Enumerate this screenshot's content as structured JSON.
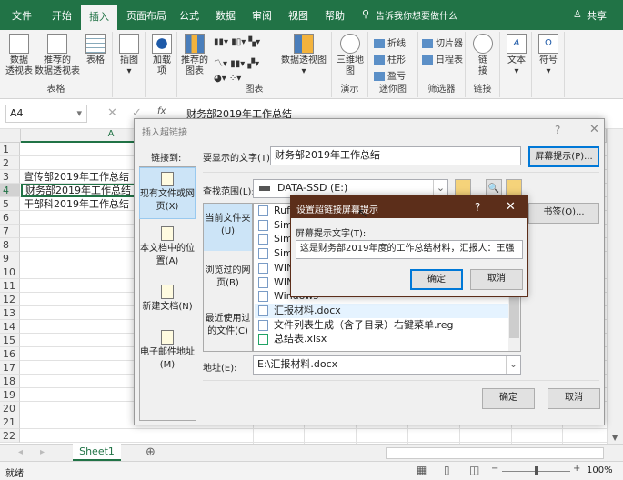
{
  "ribbon_tabs": [
    "文件",
    "开始",
    "插入",
    "页面布局",
    "公式",
    "数据",
    "审阅",
    "视图",
    "帮助"
  ],
  "active_tab": "插入",
  "search_placeholder": "告诉我你想要做什么",
  "share_label": "共享",
  "ribbon": {
    "pivot_table": "数据\n透视表",
    "recommended_pivot": "推荐的\n数据透视表",
    "table": "表格",
    "group_tables": "表格",
    "illustrations": "插图",
    "addins": "加载\n项",
    "recommended_charts": "推荐的\n图表",
    "pivot_chart": "数据透视图",
    "group_charts": "图表",
    "map3d": "三维地\n图",
    "group_tours": "演示",
    "spark_line": "折线",
    "spark_column": "柱形",
    "spark_winloss": "盈亏",
    "group_sparklines": "迷你图",
    "slicer": "切片器",
    "timeline": "日程表",
    "group_filters": "筛选器",
    "link": "链\n接",
    "group_links": "链接",
    "text": "文本",
    "symbols": "符号"
  },
  "formula_bar": {
    "name_box": "A4",
    "fx": "fx",
    "value": "财务部2019年工作总结"
  },
  "sheet": {
    "column_headers": [
      "A"
    ],
    "row_count": 22,
    "cells": [
      {
        "row": 3,
        "text": "宣传部2019年工作总结"
      },
      {
        "row": 4,
        "text": "财务部2019年工作总结"
      },
      {
        "row": 5,
        "text": "干部科2019年工作总结"
      }
    ],
    "selected_row": 4
  },
  "dialog": {
    "title": "插入超链接",
    "help": "?",
    "close": "✕",
    "link_to": "链接到:",
    "link_types": [
      "现有文件或网页(X)",
      "本文档中的位置(A)",
      "新建文档(N)",
      "电子邮件地址(M)"
    ],
    "display_text_label": "要显示的文字(T):",
    "display_text": "财务部2019年工作总结",
    "screentip_button": "屏幕提示(P)...",
    "lookin_label": "查找范围(L):",
    "lookin_value": "DATA-SSD (E:)",
    "browse_tabs": [
      "当前文件夹(U)",
      "浏览过的网页(B)",
      "最近使用过的文件(C)"
    ],
    "files": [
      "Rufus",
      "Simp",
      "Simp",
      "Simp",
      "WIN",
      "WIN",
      "Windows",
      "汇报材料.docx",
      "文件列表生成（含子目录）右键菜单.reg",
      "总结表.xlsx"
    ],
    "bookmark_button": "书签(O)...",
    "address_label": "地址(E):",
    "address": "E:\\汇报材料.docx",
    "ok": "确定",
    "cancel": "取消"
  },
  "tip_dialog": {
    "title": "设置超链接屏幕提示",
    "help": "?",
    "close": "✕",
    "label": "屏幕提示文字(T):",
    "value": "这是财务部2019年度的工作总结材料，汇报人：王强",
    "ok": "确定",
    "cancel": "取消",
    "title_color": "#5c2e1a"
  },
  "sheet_tab": "Sheet1",
  "status": {
    "ready": "就绪",
    "zoom": "100%"
  }
}
